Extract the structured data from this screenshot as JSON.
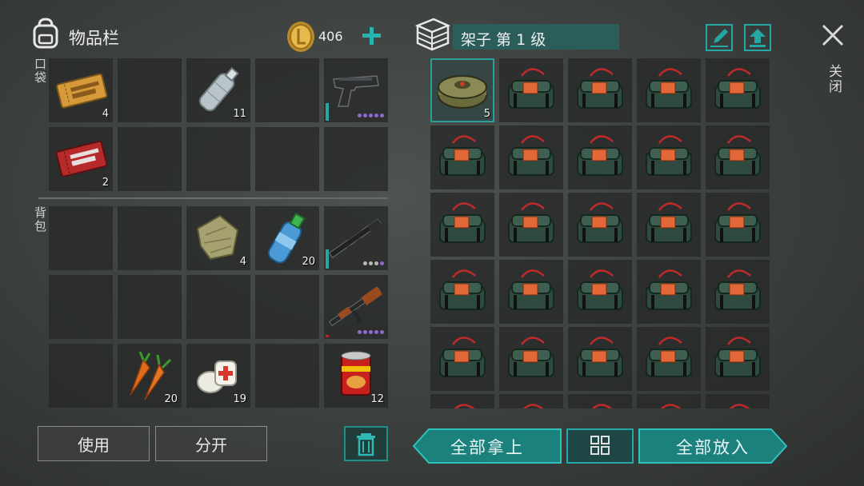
{
  "inventory": {
    "title": "物品栏",
    "coins": "406",
    "pocket_label": "口袋",
    "backpack_label": "背包",
    "pocket": {
      "coupon1_qty": "4",
      "water_bottle_qty": "11",
      "coupon2_qty": "2"
    },
    "backpack": {
      "cloth_qty": "4",
      "water_qty": "20",
      "carrot_qty": "20",
      "bandage_qty": "19",
      "can_qty": "12"
    },
    "use_label": "使用",
    "split_label": "分开"
  },
  "storage": {
    "title": "架子 第 1 级",
    "mine_qty": "5",
    "take_all_label": "全部拿上",
    "put_all_label": "全部放入"
  },
  "close_label": "关闭",
  "colors": {
    "accent": "#23a8a5",
    "button_teal": "#1f8f8c"
  }
}
